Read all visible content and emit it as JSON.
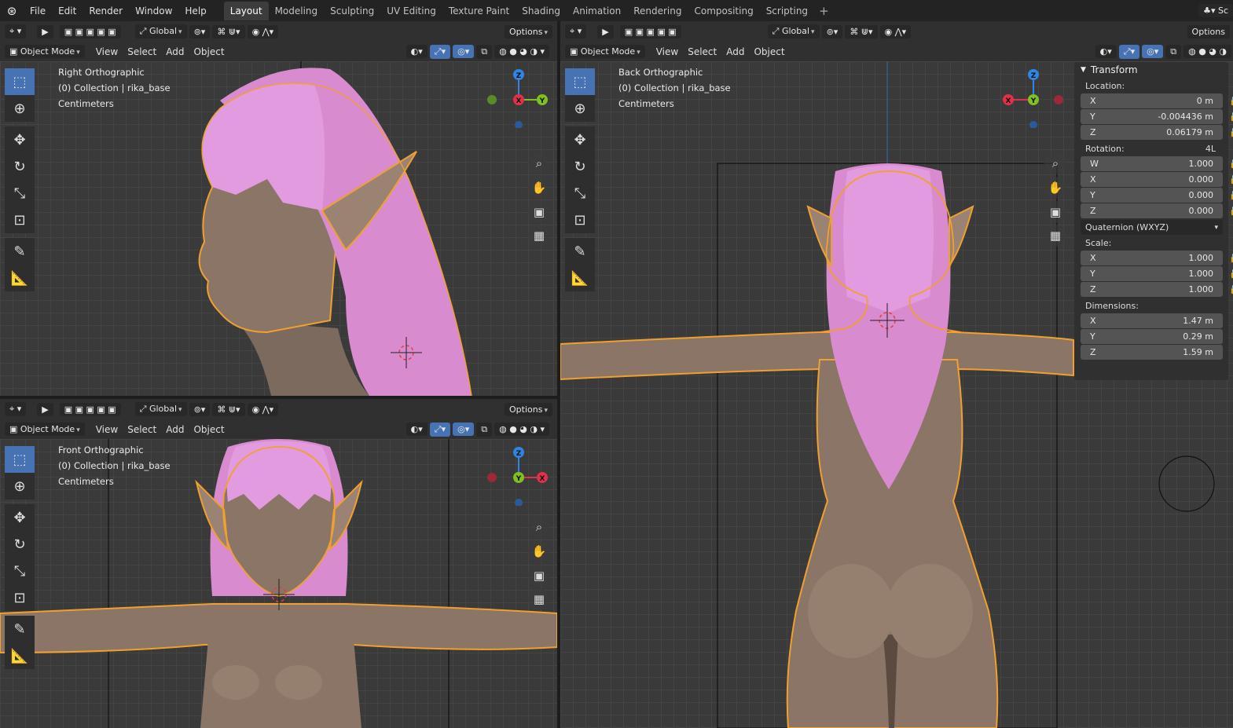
{
  "topbar": {
    "menus": [
      "File",
      "Edit",
      "Render",
      "Window",
      "Help"
    ],
    "workspaces": [
      "Layout",
      "Modeling",
      "Sculpting",
      "UV Editing",
      "Texture Paint",
      "Shading",
      "Animation",
      "Rendering",
      "Compositing",
      "Scripting"
    ],
    "active_workspace": "Layout",
    "add_tab": "+",
    "scene_trunc": "Sc"
  },
  "header": {
    "orientation": "Global",
    "options": "Options",
    "mode": "Object Mode",
    "view": "View",
    "select": "Select",
    "add": "Add",
    "object": "Object"
  },
  "viewports": {
    "right": {
      "title": "Right Orthographic",
      "collection": "(0) Collection | rika_base",
      "units": "Centimeters"
    },
    "front": {
      "title": "Front Orthographic",
      "collection": "(0) Collection | rika_base",
      "units": "Centimeters"
    },
    "back": {
      "title": "Back Orthographic",
      "collection": "(0) Collection | rika_base",
      "units": "Centimeters"
    }
  },
  "gizmo": {
    "x": "X",
    "y": "Y",
    "z": "Z"
  },
  "transform": {
    "title": "Transform",
    "location_label": "Location:",
    "location": [
      {
        "axis": "X",
        "value": "0 m"
      },
      {
        "axis": "Y",
        "value": "-0.004436 m"
      },
      {
        "axis": "Z",
        "value": "0.06179 m"
      }
    ],
    "rotation_label": "Rotation:",
    "rotation_mode_tag": "4L",
    "rotation": [
      {
        "axis": "W",
        "value": "1.000"
      },
      {
        "axis": "X",
        "value": "0.000"
      },
      {
        "axis": "Y",
        "value": "0.000"
      },
      {
        "axis": "Z",
        "value": "0.000"
      }
    ],
    "rotation_mode": "Quaternion (WXYZ)",
    "scale_label": "Scale:",
    "scale": [
      {
        "axis": "X",
        "value": "1.000"
      },
      {
        "axis": "Y",
        "value": "1.000"
      },
      {
        "axis": "Z",
        "value": "1.000"
      }
    ],
    "dimensions_label": "Dimensions:",
    "dimensions": [
      {
        "axis": "X",
        "value": "1.47 m"
      },
      {
        "axis": "Y",
        "value": "0.29 m"
      },
      {
        "axis": "Z",
        "value": "1.59 m"
      }
    ]
  },
  "colors": {
    "accent": "#4772b3",
    "selection_outline": "#f0a030",
    "hair": "#d98bd0",
    "skin": "#8a7566",
    "x_axis": "#e0304a",
    "y_axis": "#80c020",
    "z_axis": "#2f85e0"
  }
}
